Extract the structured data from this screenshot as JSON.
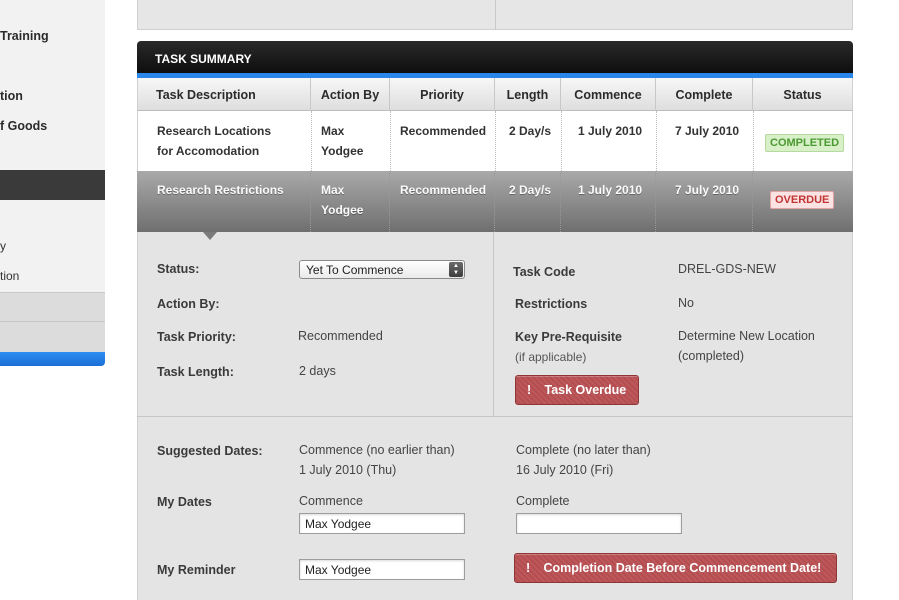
{
  "sidebar": {
    "items": [
      {
        "label": "Training"
      },
      {
        "label": "tion"
      },
      {
        "label": "f Goods"
      }
    ],
    "sub_items": [
      {
        "label": "y"
      },
      {
        "label": "tion"
      }
    ]
  },
  "task_summary": {
    "title": "TASK SUMMARY",
    "columns": [
      "Task Description",
      "Action By",
      "Priority",
      "Length",
      "Commence",
      "Complete",
      "Status"
    ],
    "rows": [
      {
        "description": [
          "Research Locations",
          "for Accomodation"
        ],
        "action_by": [
          "Max",
          "Yodgee"
        ],
        "priority": "Recommended",
        "length": "2 Day/s",
        "commence": "1 July 2010",
        "complete": "7 July 2010",
        "status": "COMPLETED"
      },
      {
        "description": [
          "Research Restrictions"
        ],
        "action_by": [
          "Max",
          "Yodgee"
        ],
        "priority": "Recommended",
        "length": "2 Day/s",
        "commence": "1 July 2010",
        "complete": "7 July 2010",
        "status": "OVERDUE"
      }
    ]
  },
  "detail": {
    "status_label": "Status:",
    "status_value": "Yet To Commence",
    "action_by_label": "Action By:",
    "priority_label": "Task Priority:",
    "priority_value": "Recommended",
    "length_label": "Task Length:",
    "length_value": "2 days",
    "task_code_label": "Task Code",
    "task_code_value": "DREL-GDS-NEW",
    "restrictions_label": "Restrictions",
    "restrictions_value": "No",
    "prereq_label": "Key Pre-Requisite",
    "prereq_sublabel": "(if applicable)",
    "prereq_value": "Determine New Location",
    "prereq_value2": "(completed)",
    "overdue_button": "Task Overdue"
  },
  "dates": {
    "suggested_label": "Suggested Dates:",
    "commence_hint": "Commence (no earlier than)",
    "commence_date": "1 July 2010 (Thu)",
    "complete_hint": "Complete (no later than)",
    "complete_date": "16 July 2010 (Fri)",
    "my_dates_label": "My Dates",
    "commence_label": "Commence",
    "commence_value": "Max Yodgee",
    "complete_label": "Complete",
    "complete_value": "",
    "reminder_label": "My Reminder",
    "reminder_value": "Max Yodgee",
    "warning_button": "Completion Date Before Commencement Date!"
  },
  "icons": {
    "exclamation": "!",
    "stepper": "▲▼"
  },
  "colors": {
    "header_blue": "#2a86ea",
    "completed_green": "#4b9a32",
    "overdue_red": "#c23434",
    "warning_button": "#b94f52"
  }
}
